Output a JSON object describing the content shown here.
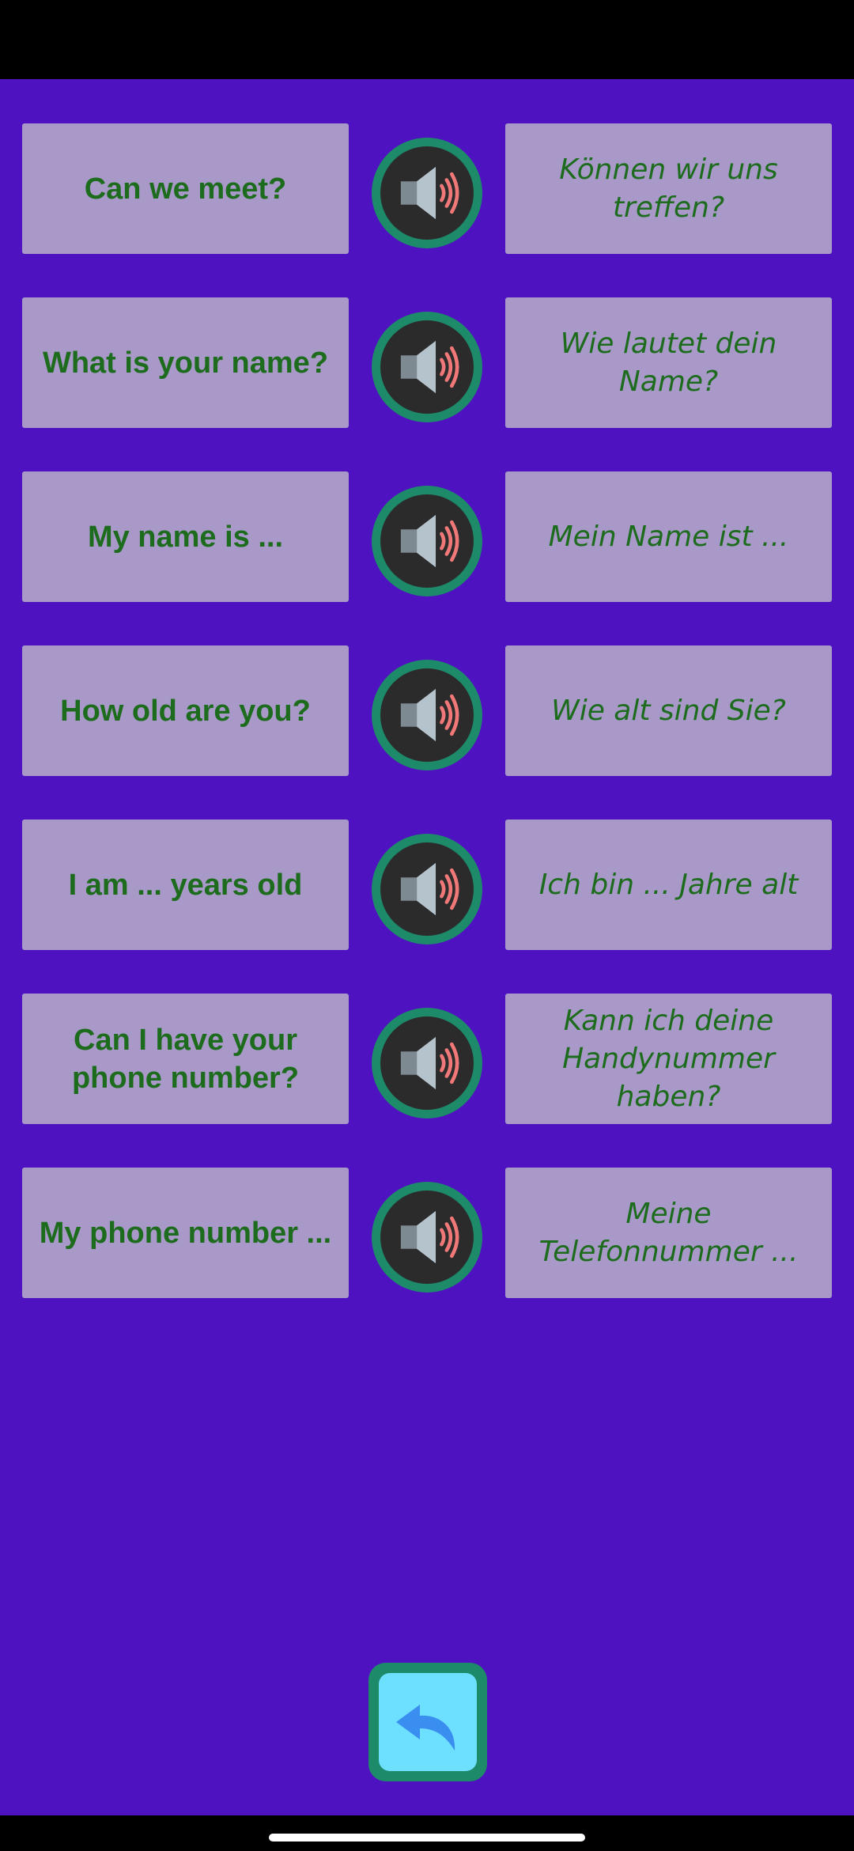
{
  "colors": {
    "background": "#4f12c0",
    "card": "#a899c8",
    "text": "#1d6b1d",
    "button_ring": "#1d8a6a",
    "back_fill": "#6ee0ff"
  },
  "phrases": [
    {
      "en": "Can we meet?",
      "de": "Können wir uns treffen?"
    },
    {
      "en": "What is your name?",
      "de": "Wie lautet dein Name?"
    },
    {
      "en": "My name is ...",
      "de": "Mein Name ist ..."
    },
    {
      "en": "How old are you?",
      "de": "Wie alt sind Sie?"
    },
    {
      "en": "I am ... years old",
      "de": "Ich bin ... Jahre alt"
    },
    {
      "en": "Can I have your phone number?",
      "de": "Kann ich deine Handynummer haben?"
    },
    {
      "en": "My phone number ...",
      "de": "Meine Telefonnummer ..."
    }
  ],
  "icons": {
    "play": "speaker-icon",
    "back": "back-arrow-icon"
  }
}
